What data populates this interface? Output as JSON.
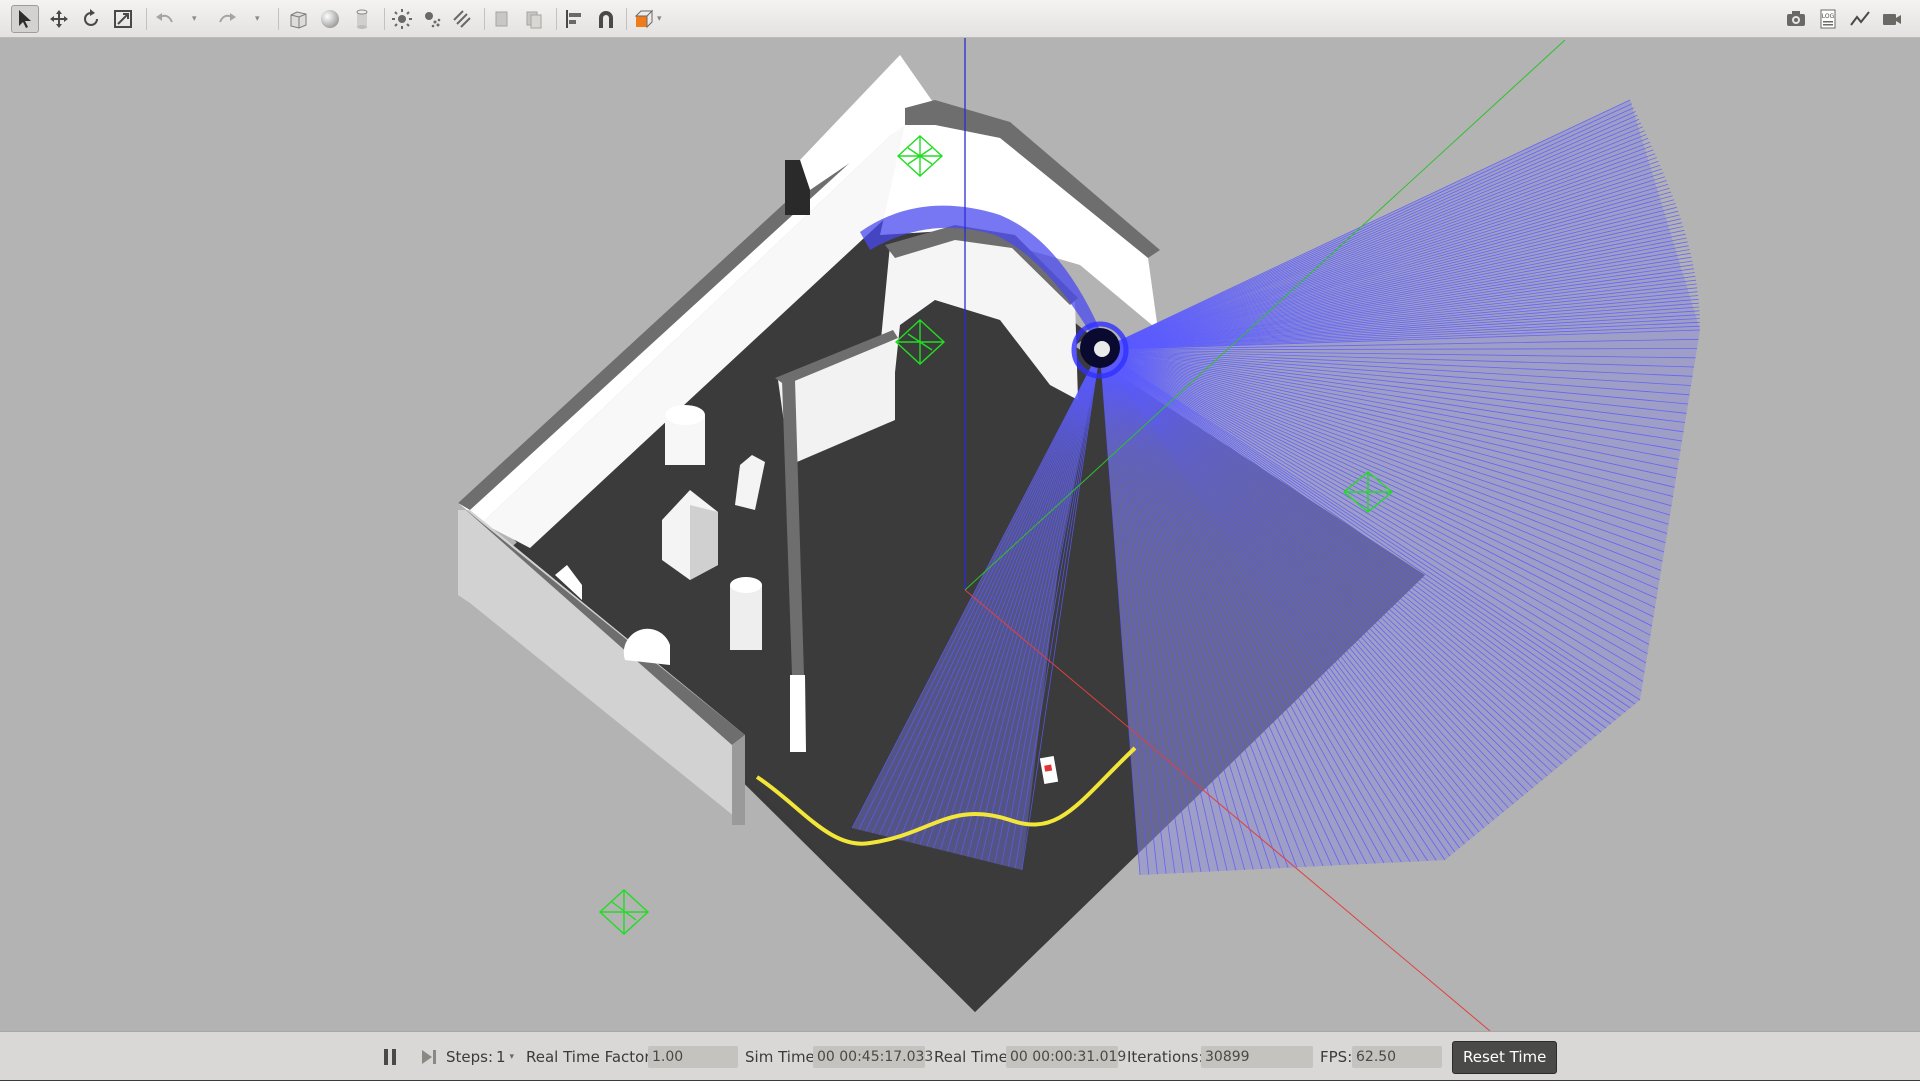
{
  "toolbar": {
    "icons": [
      "select-icon",
      "translate-icon",
      "rotate-icon",
      "scale-icon",
      "undo-icon",
      "redo-icon",
      "box-icon",
      "sphere-icon",
      "cylinder-icon",
      "point-light-icon",
      "spot-light-icon",
      "directional-light-icon",
      "copy-icon",
      "paste-icon",
      "align-icon",
      "snap-icon",
      "view-angle-icon",
      "screenshot-icon",
      "log-icon",
      "plot-icon",
      "record-video-icon"
    ],
    "right_log_label": "LOG"
  },
  "status": {
    "steps_label": "Steps:",
    "steps_value": "1",
    "rtf_label": "Real Time Factor:",
    "rtf_value": "1.00",
    "sim_time_label": "Sim Time:",
    "sim_time_value": "00 00:45:17.033",
    "real_time_label": "Real Time:",
    "real_time_value": "00 00:00:31.019",
    "iterations_label": "Iterations:",
    "iterations_value": "30899",
    "fps_label": "FPS:",
    "fps_value": "62.50",
    "reset_label": "Reset Time"
  },
  "colors": {
    "viewport_bg": "#b3b3b3",
    "floor": "#3a3a3a",
    "laser": "#5a5aff",
    "path": "#f0e030",
    "marker": "#22dd22"
  }
}
